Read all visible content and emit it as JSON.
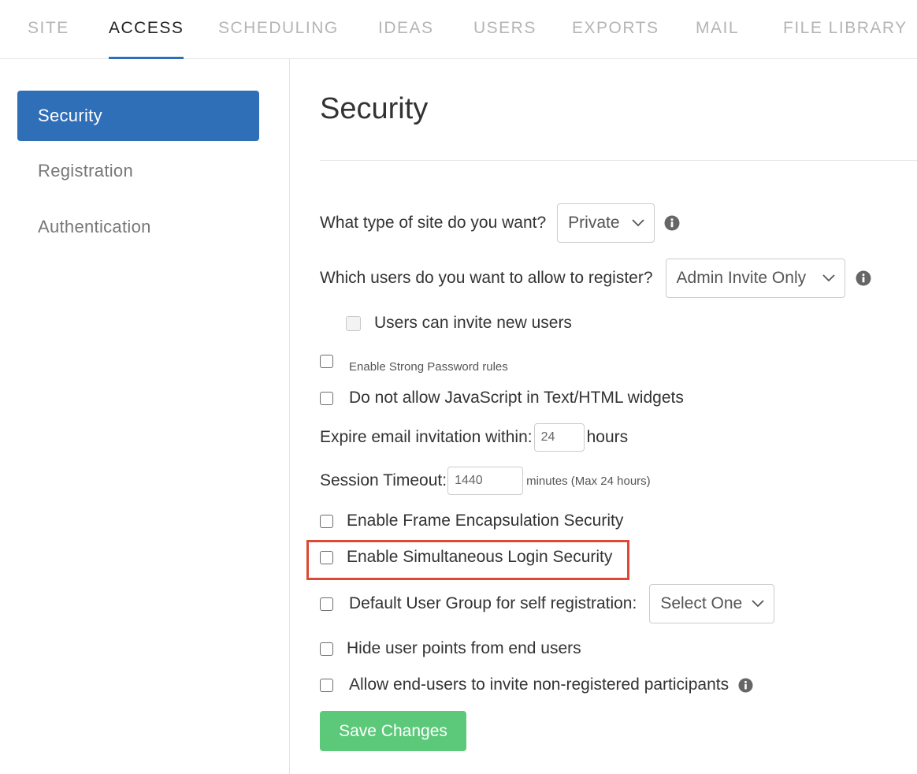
{
  "nav": {
    "tabs": [
      {
        "label": "SITE"
      },
      {
        "label": "ACCESS"
      },
      {
        "label": "SCHEDULING"
      },
      {
        "label": "IDEAS"
      },
      {
        "label": "USERS"
      },
      {
        "label": "EXPORTS"
      },
      {
        "label": "MAIL"
      },
      {
        "label": "FILE LIBRARY"
      }
    ],
    "active_tab": "ACCESS"
  },
  "sidebar": {
    "items": [
      {
        "label": "Security"
      },
      {
        "label": "Registration"
      },
      {
        "label": "Authentication"
      }
    ],
    "active_item": "Security"
  },
  "main": {
    "title": "Security",
    "site_type": {
      "label": "What type of site do you want?",
      "value": "Private",
      "icon": "info-icon"
    },
    "register": {
      "label": "Which users do you want to allow to register?",
      "value": "Admin Invite Only",
      "icon": "info-icon"
    },
    "users_invite": {
      "label": "Users can invite new users",
      "checked": false,
      "disabled": true
    },
    "strong_password": {
      "label": "Enable Strong Password rules",
      "checked": false
    },
    "no_javascript": {
      "label": "Do not allow JavaScript in Text/HTML widgets",
      "checked": false
    },
    "expire_invite": {
      "label": "Expire email invitation within:",
      "value": "24",
      "unit": "hours"
    },
    "session_timeout": {
      "label": "Session Timeout:",
      "value": "1440",
      "unit": "minutes (Max 24 hours)"
    },
    "frame_encapsulation": {
      "label": "Enable Frame Encapsulation Security",
      "checked": false
    },
    "simultaneous_login": {
      "label": "Enable Simultaneous Login Security",
      "checked": false,
      "highlight_color": "#dc4a35"
    },
    "default_group": {
      "label": "Default User Group for self registration:",
      "value": "Select One",
      "checked": false
    },
    "hide_points": {
      "label": "Hide user points from end users",
      "checked": false
    },
    "invite_participants": {
      "label": "Allow end-users to invite non-registered participants",
      "checked": false,
      "icon": "info-icon"
    },
    "save_label": "Save Changes"
  },
  "colors": {
    "accent": "#2f6fb8",
    "save_button": "#5cc97a",
    "highlight": "#dc4a35"
  }
}
